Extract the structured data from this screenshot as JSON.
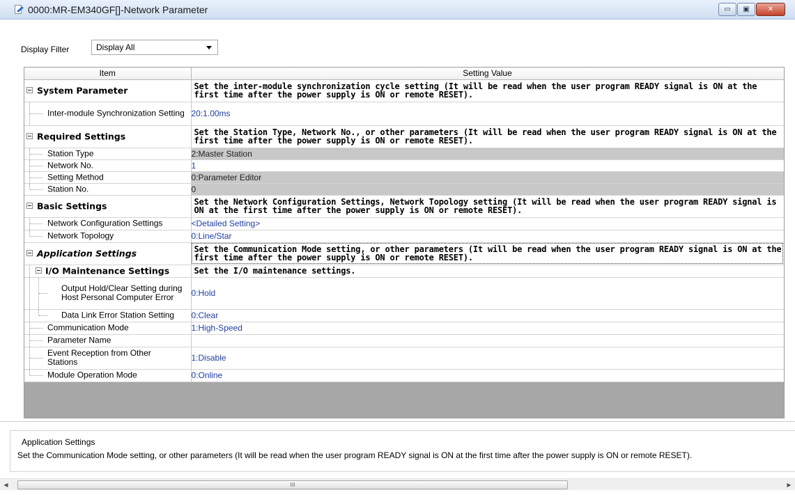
{
  "window": {
    "title": "0000:MR-EM340GF[]-Network Parameter",
    "minimize_glyph": "▭",
    "maximize_glyph": "▣",
    "close_glyph": "✕"
  },
  "filter": {
    "label": "Display Filter",
    "value": "Display All"
  },
  "table": {
    "headers": {
      "item": "Item",
      "value": "Setting Value"
    },
    "system_parameter": {
      "label": "System Parameter",
      "desc": "Set the inter-module synchronization cycle setting (It will be read when the user program READY signal is ON at the first time after the power supply is ON or remote RESET).",
      "items": [
        {
          "label": "Inter-module Synchronization Setting",
          "value": "20:1.00ms"
        }
      ]
    },
    "required_settings": {
      "label": "Required Settings",
      "desc": "Set the Station Type, Network No., or other parameters (It will be read when the user program READY signal is ON at the first time after the power supply is ON or remote RESET).",
      "items": [
        {
          "label": "Station Type",
          "value": "2:Master Station"
        },
        {
          "label": "Network No.",
          "value": "1"
        },
        {
          "label": "Setting Method",
          "value": "0:Parameter Editor"
        },
        {
          "label": "Station No.",
          "value": "0"
        }
      ]
    },
    "basic_settings": {
      "label": "Basic Settings",
      "desc": "Set the Network Configuration Settings, Network Topology setting (It will be read when the user program READY signal is ON at the first time after the power supply is ON or remote RESET).",
      "items": [
        {
          "label": "Network Configuration Settings",
          "value": "<Detailed Setting>"
        },
        {
          "label": "Network Topology",
          "value": "0:Line/Star"
        }
      ]
    },
    "application_settings": {
      "label": "Application Settings",
      "desc": "Set the Communication Mode setting, or other parameters (It will be read when the user program READY signal is ON at the first time after the power supply is ON or remote RESET).",
      "io_maintenance": {
        "label": "I/O Maintenance Settings",
        "desc": "Set the I/O maintenance settings.",
        "items": [
          {
            "label": "Output Hold/Clear Setting during Host Personal Computer Error",
            "value": "0:Hold"
          },
          {
            "label": "Data Link Error Station Setting",
            "value": "0:Clear"
          }
        ]
      },
      "items": [
        {
          "label": "Communication Mode",
          "value": "1:High-Speed"
        },
        {
          "label": "Parameter Name",
          "value": ""
        },
        {
          "label": "Event Reception from Other Stations",
          "value": "1:Disable"
        },
        {
          "label": "Module Operation Mode",
          "value": "0:Online"
        }
      ]
    }
  },
  "description_pane": {
    "title": "Application Settings",
    "text": "Set the Communication Mode setting, or other parameters (It will be read when the user program READY signal is ON at the first time after the power supply is ON or remote RESET)."
  },
  "scrollbar": {
    "thumb_grip": "III"
  },
  "colors": {
    "value_text": "#1e3ea8",
    "readonly_bg": "#c8c8c8",
    "grid_bottom": "#a7a7a7"
  }
}
